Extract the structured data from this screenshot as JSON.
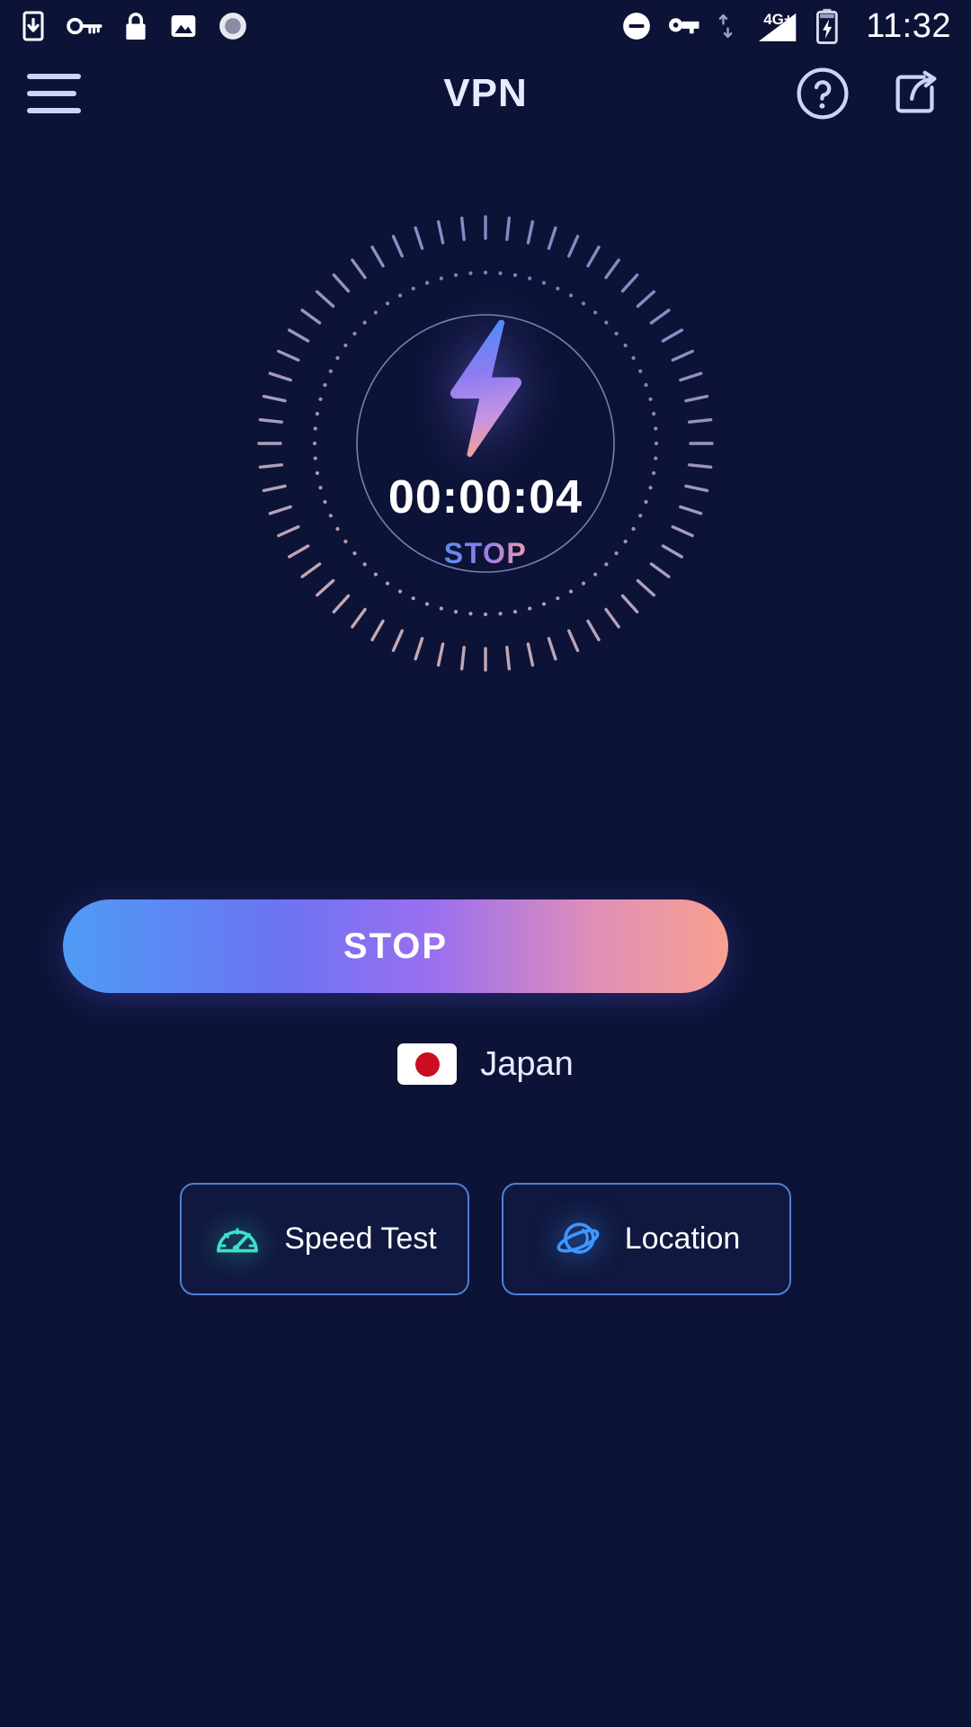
{
  "theme": {
    "background": "#0d1337",
    "accent_blue": "#4f9bf5",
    "accent_purple": "#9b6ff0",
    "accent_pink": "#f8a08f",
    "tile_border": "#4f7fd6",
    "speed_icon_color": "#3ce1c8",
    "globe_icon_color": "#4096ff",
    "flag_red": "#cc0d20"
  },
  "statusbar": {
    "left_icons": [
      "download-to-phone-icon",
      "vpn-key-icon",
      "lock-icon",
      "image-icon",
      "record-icon"
    ],
    "right_icons": [
      "do-not-disturb-icon",
      "vpn-key-icon",
      "data-transfer-icon"
    ],
    "network_label": "4G+",
    "signal_icon": "signal-bars-icon",
    "battery_icon": "battery-charging-icon",
    "time": "11:32"
  },
  "header": {
    "menu_icon": "hamburger-menu-icon",
    "title": "VPN",
    "help_icon": "help-circle-icon",
    "share_icon": "share-icon"
  },
  "dial": {
    "bolt_icon": "lightning-bolt-icon",
    "timer": "00:00:04",
    "status_label": "STOP",
    "tick_count": 60,
    "dot_count": 72
  },
  "main_button": {
    "label": "STOP"
  },
  "country": {
    "flag_icon": "japan-flag-icon",
    "name": "Japan"
  },
  "tiles": [
    {
      "icon": "speedometer-icon",
      "label": "Speed Test"
    },
    {
      "icon": "globe-ring-icon",
      "label": "Location"
    }
  ]
}
